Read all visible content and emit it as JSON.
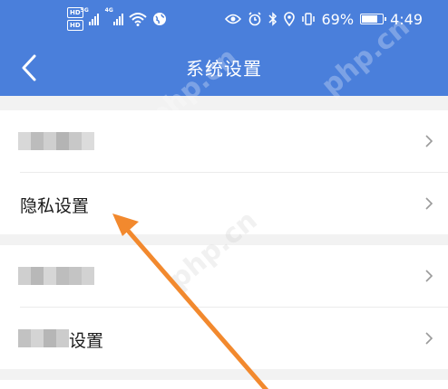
{
  "status_bar": {
    "hd_1": "HD",
    "hd_2": "HD",
    "net_1": "5G",
    "net_2": "4G",
    "battery": "69%",
    "battery_level": 0.69,
    "time": "4:49"
  },
  "header": {
    "title": "系统设置"
  },
  "rows": [
    {
      "label": ""
    },
    {
      "label": "隐私设置"
    },
    {
      "label": ""
    },
    {
      "label": "设置"
    }
  ],
  "watermark": "php.cn",
  "colors": {
    "header": "#4a7fdb",
    "arrow": "#f2892e",
    "background": "#f2f2f2"
  }
}
